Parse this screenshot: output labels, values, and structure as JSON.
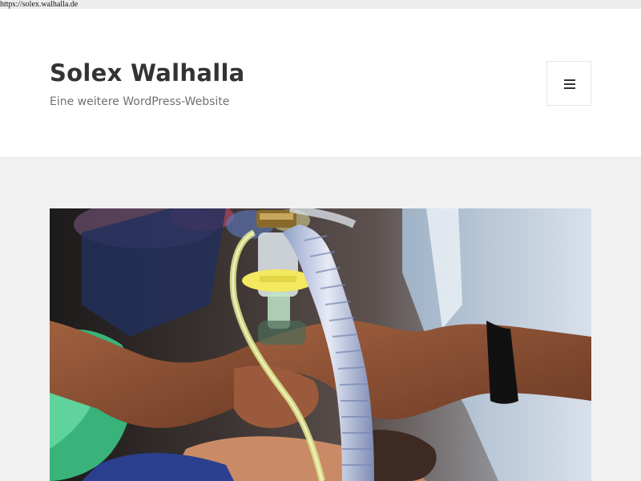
{
  "browser": {
    "url": "https://solex.walhalla.de"
  },
  "header": {
    "site_title": "Solex Walhalla",
    "site_description": "Eine weitere WordPress-Website",
    "menu_icon": "hamburger-menu-icon"
  },
  "featured_image": {
    "icon": "photo-image-icon"
  },
  "colors": {
    "page_background": "#f1f1f1",
    "header_background": "#ffffff",
    "title_text": "#333333",
    "description_text": "#707070"
  }
}
